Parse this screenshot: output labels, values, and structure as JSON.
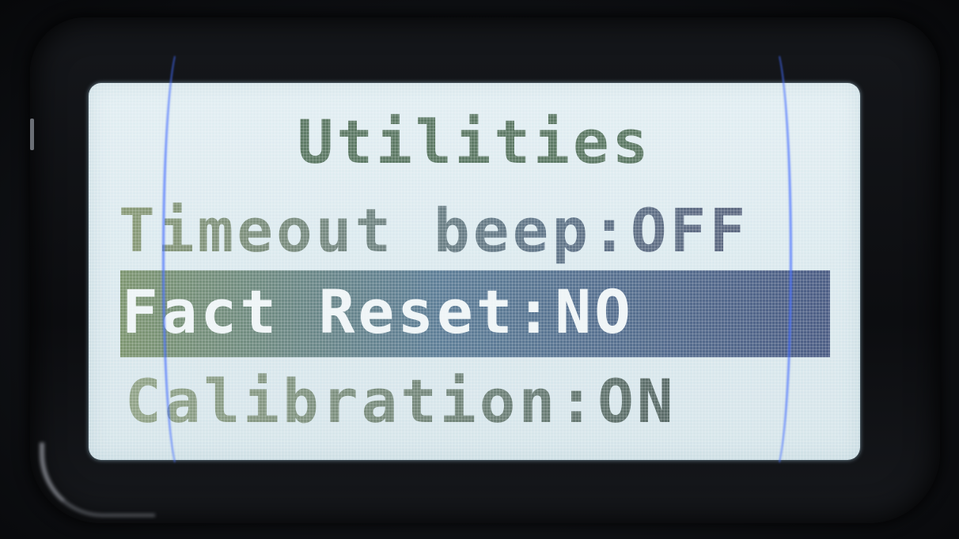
{
  "screen": {
    "title": "Utilities",
    "menu_items": [
      {
        "text": "Timeout beep:OFF",
        "selected": false
      },
      {
        "text": "Fact Reset:NO",
        "selected": true
      },
      {
        "text": "Calibration:ON",
        "selected": false
      }
    ]
  },
  "colors": {
    "lcd_background": "#dbe9ee",
    "text_green": "#5e7a66",
    "selection_bar": "#5f7f98",
    "selected_text": "#eef4f6",
    "bezel": "#0c0d10"
  }
}
